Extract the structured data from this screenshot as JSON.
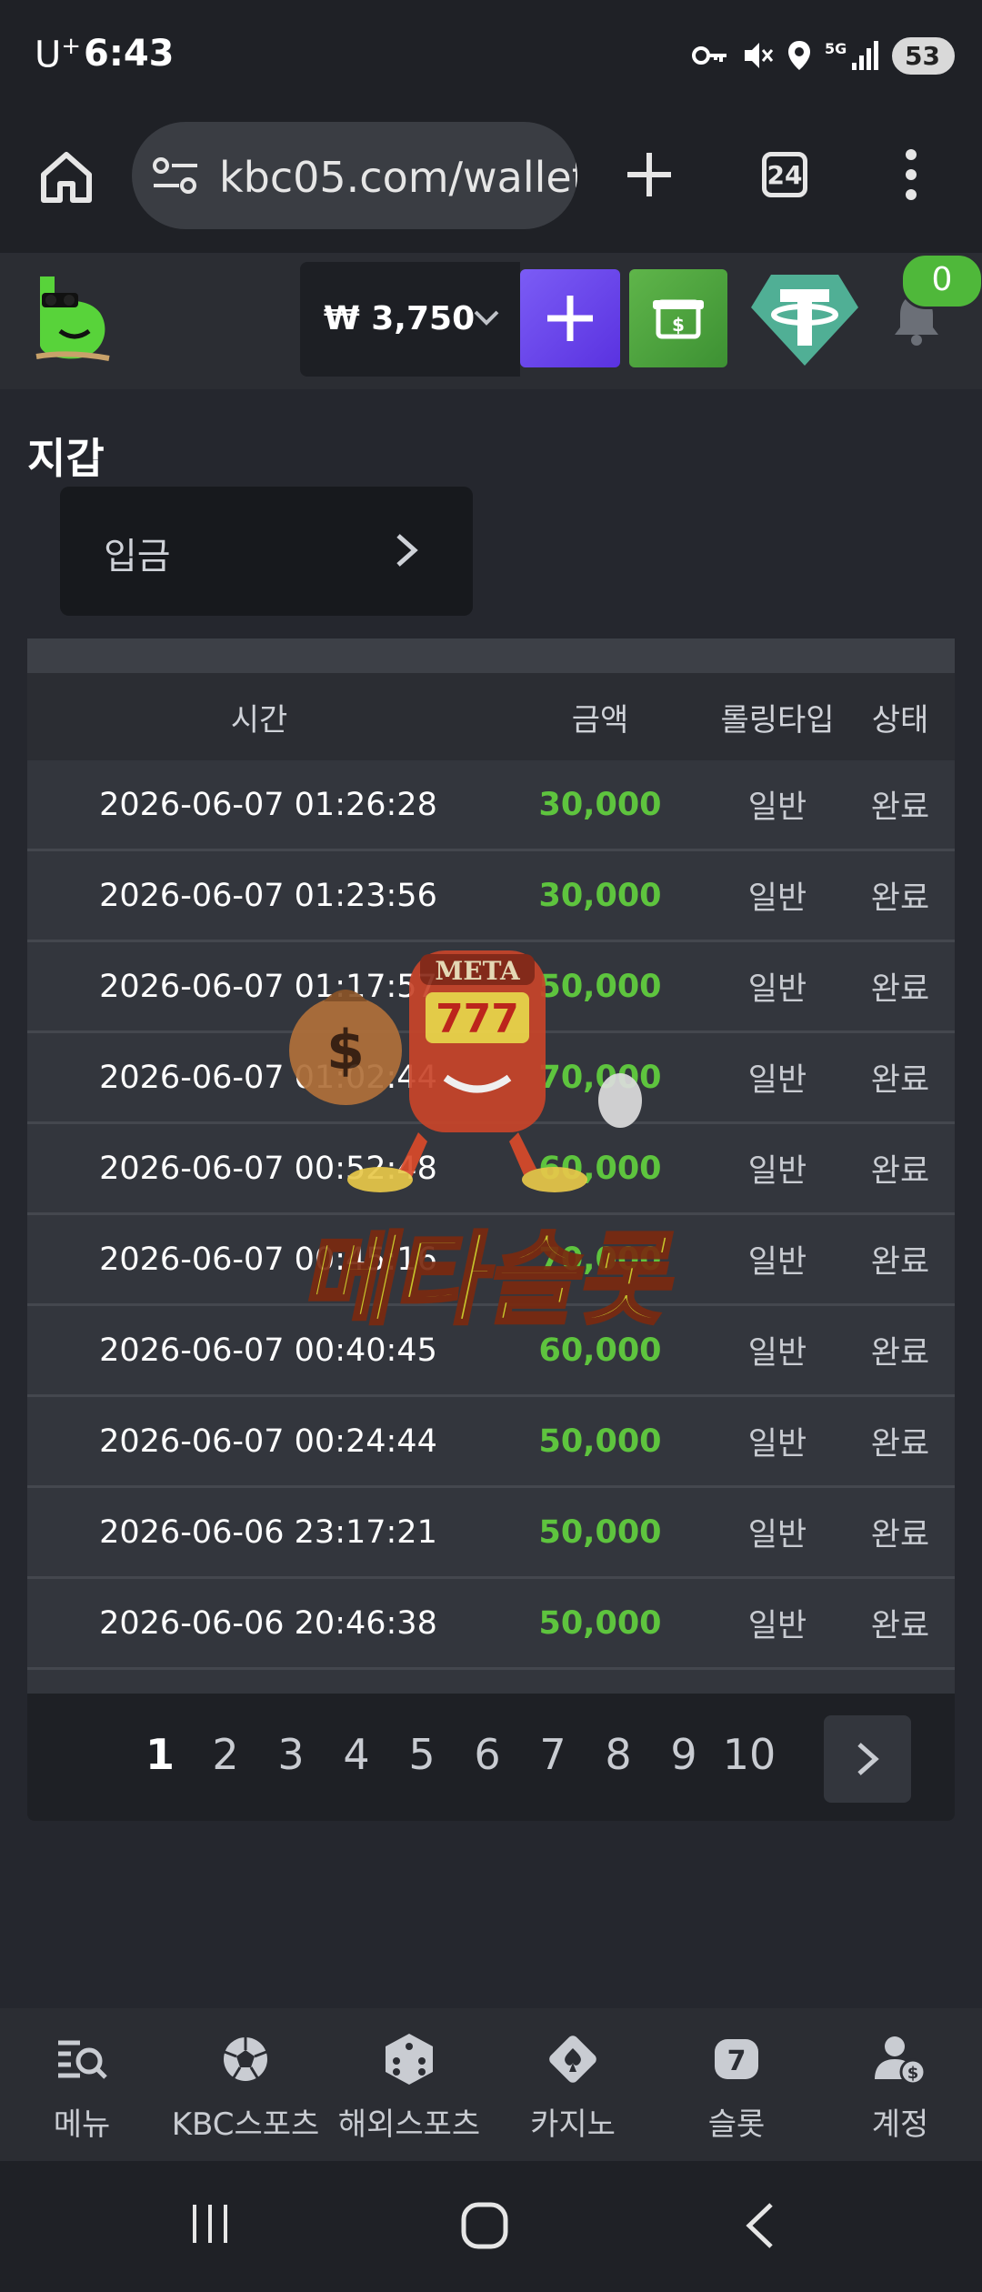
{
  "status_bar": {
    "carrier": "U",
    "carrier_sup": "+",
    "time": "6:43",
    "battery": "53"
  },
  "browser": {
    "url": "kbc05.com/wallet",
    "tab_count": "24"
  },
  "header": {
    "balance": "₩ 3,750",
    "notification_count": "0"
  },
  "page": {
    "title": "지갑",
    "deposit_label": "입금"
  },
  "table": {
    "headers": [
      "시간",
      "금액",
      "롤링타입",
      "상태"
    ],
    "rows": [
      {
        "time": "2026-06-07 01:26:28",
        "amount": "30,000",
        "rolling": "일반",
        "status": "완료"
      },
      {
        "time": "2026-06-07 01:23:56",
        "amount": "30,000",
        "rolling": "일반",
        "status": "완료"
      },
      {
        "time": "2026-06-07 01:17:57",
        "amount": "50,000",
        "rolling": "일반",
        "status": "완료"
      },
      {
        "time": "2026-06-07 01:02:44",
        "amount": "70,000",
        "rolling": "일반",
        "status": "완료"
      },
      {
        "time": "2026-06-07 00:52:48",
        "amount": "60,000",
        "rolling": "일반",
        "status": "완료"
      },
      {
        "time": "2026-06-07 00:45:16",
        "amount": "70,000",
        "rolling": "일반",
        "status": "완료"
      },
      {
        "time": "2026-06-07 00:40:45",
        "amount": "60,000",
        "rolling": "일반",
        "status": "완료"
      },
      {
        "time": "2026-06-07 00:24:44",
        "amount": "50,000",
        "rolling": "일반",
        "status": "완료"
      },
      {
        "time": "2026-06-06 23:17:21",
        "amount": "50,000",
        "rolling": "일반",
        "status": "완료"
      },
      {
        "time": "2026-06-06 20:46:38",
        "amount": "50,000",
        "rolling": "일반",
        "status": "완료"
      }
    ]
  },
  "pagination": {
    "pages": [
      "1",
      "2",
      "3",
      "4",
      "5",
      "6",
      "7",
      "8",
      "9",
      "10"
    ],
    "current": "1"
  },
  "watermark": {
    "sign_text": "META",
    "slot_text": "777",
    "brand_text": "메타슬롯"
  },
  "bottom_nav": [
    {
      "label": "메뉴",
      "icon": "menu-search-icon"
    },
    {
      "label": "KBC스포츠",
      "icon": "soccer-ball-icon"
    },
    {
      "label": "해외스포츠",
      "icon": "dice-icon"
    },
    {
      "label": "카지노",
      "icon": "playing-card-icon"
    },
    {
      "label": "슬롯",
      "icon": "slot-seven-icon"
    },
    {
      "label": "계정",
      "icon": "account-icon"
    }
  ],
  "colors": {
    "amount_green": "#5ec43e",
    "plus_purple": "#6a45ea",
    "cash_green": "#4fa53f",
    "tether_teal": "#50af95"
  }
}
